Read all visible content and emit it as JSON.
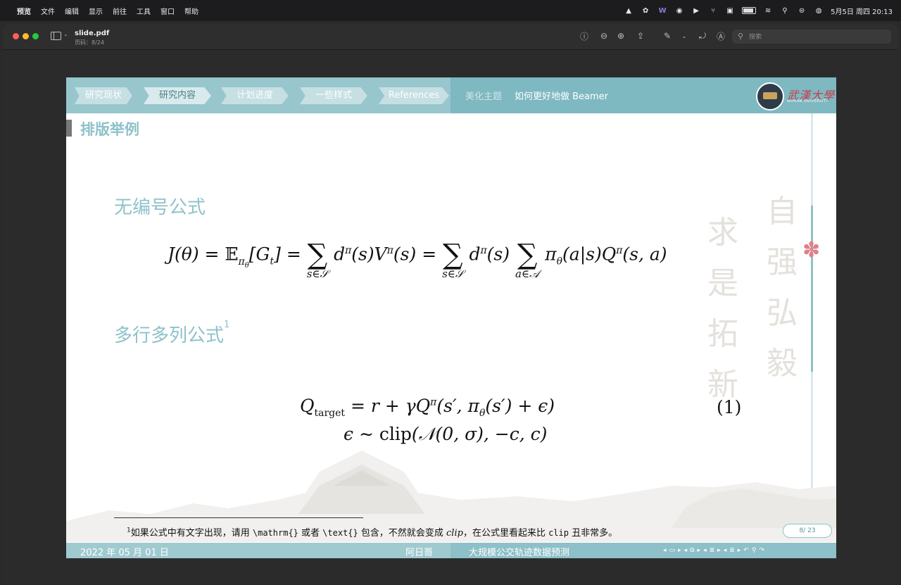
{
  "menubar": {
    "app": "预览",
    "items": [
      "文件",
      "编辑",
      "显示",
      "前往",
      "工具",
      "窗口",
      "帮助"
    ],
    "datetime": "5月5日 周四 20:13"
  },
  "window": {
    "doc_title": "slide.pdf",
    "doc_page": "页码：8/24",
    "search_placeholder": "搜索"
  },
  "slide": {
    "nav_tabs": [
      "研究现状",
      "研究内容",
      "计划进度",
      "一些样式",
      "References"
    ],
    "active_tab_index": 1,
    "theme_label": "美化主题",
    "theme_title": "如何更好地做 Beamer",
    "logo_cn": "武漢大學",
    "logo_en": "WUHAN UNIVERSITY",
    "frame_title": "排版举例",
    "section1": "无编号公式",
    "section2": "多行多列公式",
    "section2_footmark": "1",
    "equation_number": "(1)",
    "footnote": {
      "mark": "1",
      "text_a": "如果公式中有文字出现，请用 ",
      "code_a": "\\mathrm{}",
      "text_b": " 或者 ",
      "code_b": "\\text{}",
      "text_c": " 包含，不然就会变成 ",
      "italic": "clip",
      "text_d": "，在公式里看起来比 ",
      "code_c": "clip",
      "text_e": " 丑非常多。"
    },
    "page_badge": "8/ 23",
    "footer": {
      "date": "2022 年 05 月 01 日",
      "author": "阿日哥",
      "title": "大规模公交轨迹数据预测"
    },
    "calligraphy_col1": "自强弘毅",
    "calligraphy_col2": "求是拓新"
  },
  "colors": {
    "accent": "#8ec2ca",
    "header": "#7eb8c1",
    "flower": "#e07f88",
    "logo_red": "#c2404a"
  }
}
